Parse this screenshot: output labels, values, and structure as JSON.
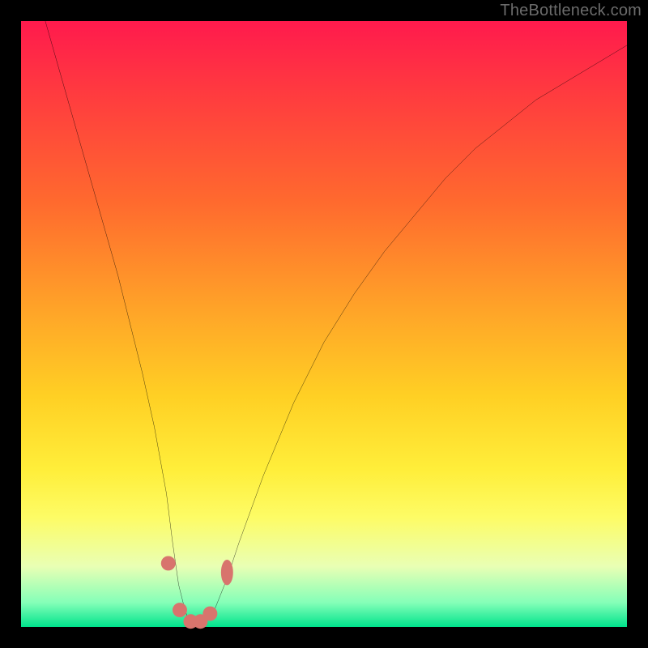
{
  "watermark": {
    "text": "TheBottleneck.com"
  },
  "chart_data": {
    "type": "line",
    "title": "",
    "xlabel": "",
    "ylabel": "",
    "xlim": [
      0,
      100
    ],
    "ylim": [
      0,
      100
    ],
    "grid": false,
    "legend": false,
    "series": [
      {
        "name": "bottleneck-curve",
        "stroke": "#000000",
        "x": [
          4,
          6,
          8,
          10,
          12,
          14,
          16,
          18,
          20,
          22,
          24,
          25,
          26,
          27,
          28,
          30,
          32,
          34,
          36,
          40,
          45,
          50,
          55,
          60,
          65,
          70,
          75,
          80,
          85,
          90,
          95,
          100
        ],
        "y": [
          100,
          93,
          86,
          79,
          72,
          65,
          58,
          50,
          42,
          33,
          22,
          14,
          7,
          3,
          0,
          0,
          3,
          8,
          14,
          25,
          37,
          47,
          55,
          62,
          68,
          74,
          79,
          83,
          87,
          90,
          93,
          96
        ]
      }
    ],
    "markers": [
      {
        "name": "dot-left-shoulder",
        "shape": "circle",
        "x": 24.3,
        "y": 10.5,
        "r": 1.2,
        "fill": "#d8746d"
      },
      {
        "name": "dot-valley-left",
        "shape": "circle",
        "x": 26.2,
        "y": 2.8,
        "r": 1.2,
        "fill": "#d8746d"
      },
      {
        "name": "dot-valley-bottom1",
        "shape": "circle",
        "x": 28.0,
        "y": 0.9,
        "r": 1.2,
        "fill": "#d8746d"
      },
      {
        "name": "dot-valley-bottom2",
        "shape": "circle",
        "x": 29.6,
        "y": 0.9,
        "r": 1.2,
        "fill": "#d8746d"
      },
      {
        "name": "dot-valley-right",
        "shape": "circle",
        "x": 31.2,
        "y": 2.2,
        "r": 1.2,
        "fill": "#d8746d"
      },
      {
        "name": "lozenge-right-shoulder",
        "shape": "lozenge",
        "x": 34.0,
        "y": 9.0,
        "w": 2.0,
        "h": 4.2,
        "fill": "#d8746d"
      }
    ],
    "background_gradient": {
      "stops": [
        {
          "pos": 0,
          "color": "#ff1a4d"
        },
        {
          "pos": 30,
          "color": "#ff6a2e"
        },
        {
          "pos": 62,
          "color": "#ffd024"
        },
        {
          "pos": 82,
          "color": "#fdfc66"
        },
        {
          "pos": 100,
          "color": "#00e38c"
        }
      ]
    }
  }
}
